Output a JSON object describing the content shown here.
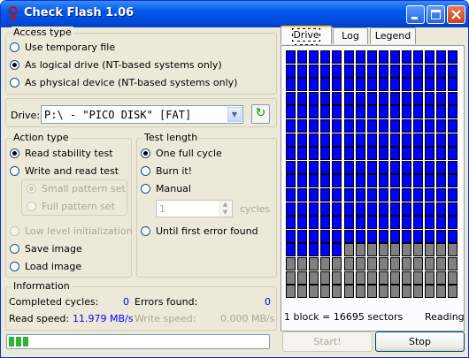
{
  "window": {
    "title": "Check Flash 1.06"
  },
  "access_type": {
    "label": "Access type",
    "options": [
      {
        "label": "Use temporary file",
        "selected": false
      },
      {
        "label": "As logical drive (NT-based systems only)",
        "selected": true
      },
      {
        "label": "As physical device (NT-based systems only)",
        "selected": false
      }
    ]
  },
  "drive": {
    "label": "Drive:",
    "value": "P:\\ - \"PICO DISK\" [FAT]"
  },
  "action_type": {
    "label": "Action type",
    "options": [
      {
        "label": "Read stability test",
        "selected": true,
        "enabled": true
      },
      {
        "label": "Write and read test",
        "selected": false,
        "enabled": true
      },
      {
        "label": "Small pattern set",
        "selected": true,
        "enabled": false
      },
      {
        "label": "Full pattern set",
        "selected": false,
        "enabled": false
      },
      {
        "label": "Low level initialization",
        "selected": false,
        "enabled": false
      },
      {
        "label": "Save image",
        "selected": false,
        "enabled": true
      },
      {
        "label": "Load image",
        "selected": false,
        "enabled": true
      }
    ]
  },
  "test_length": {
    "label": "Test length",
    "options": [
      {
        "label": "One full cycle",
        "selected": true
      },
      {
        "label": "Burn it!",
        "selected": false
      },
      {
        "label": "Manual",
        "selected": false
      },
      {
        "label": "Until first error found",
        "selected": false
      }
    ],
    "cycles_value": "1",
    "cycles_label": "cycles"
  },
  "information": {
    "label": "Information",
    "completed_cycles_label": "Completed cycles:",
    "completed_cycles_value": "0",
    "errors_found_label": "Errors found:",
    "errors_found_value": "0",
    "read_speed_label": "Read speed:",
    "read_speed_value": "11.979 MB/s",
    "write_speed_label": "Write speed:",
    "write_speed_value": "0.000 MB/s"
  },
  "tabs": [
    {
      "label": "Drive map",
      "active": true
    },
    {
      "label": "Log",
      "active": false
    },
    {
      "label": "Legend",
      "active": false
    }
  ],
  "drive_map": {
    "columns": 15,
    "rows": 18,
    "blocks_done": 215,
    "done_color": "#0000ff",
    "pending_color": "#808080"
  },
  "status": {
    "block_info": "1 block = 16695 sectors",
    "state": "Reading"
  },
  "buttons": {
    "start": "Start!",
    "stop": "Stop"
  },
  "progress": {
    "fraction": 0.08
  }
}
